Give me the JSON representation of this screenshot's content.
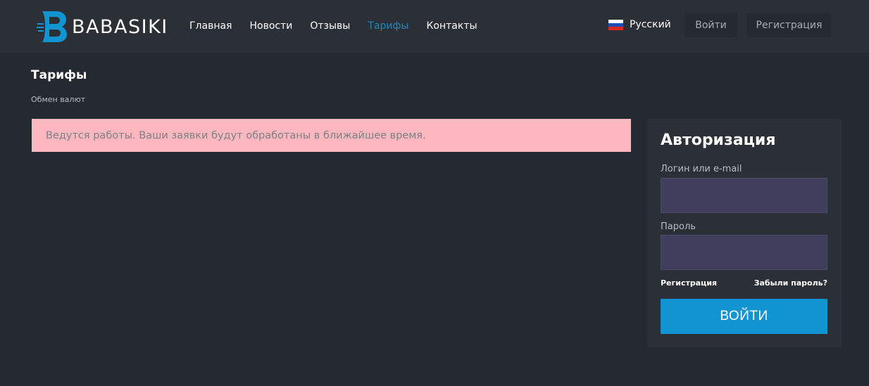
{
  "brand": {
    "name": "BABASIKI",
    "accent": "#1194d2"
  },
  "nav": {
    "items": [
      {
        "label": "Главная"
      },
      {
        "label": "Новости"
      },
      {
        "label": "Отзывы"
      },
      {
        "label": "Тарифы",
        "active": true
      },
      {
        "label": "Контакты"
      }
    ]
  },
  "language": {
    "label": "Русский",
    "icon": "russia-flag-icon"
  },
  "header_buttons": {
    "login": "Войти",
    "register": "Регистрация"
  },
  "page": {
    "title": "Тарифы",
    "breadcrumb": "Обмен валют"
  },
  "alert": {
    "text": "Ведутся работы. Ваши заявки будут обработаны в ближайшее время.",
    "color": "#fdb8bf"
  },
  "auth": {
    "title": "Авторизация",
    "login_label": "Логин или e-mail",
    "login_value": "",
    "password_label": "Пароль",
    "password_value": "",
    "register_link": "Регистрация",
    "forgot_link": "Забыли пароль?",
    "submit": "ВОЙТИ"
  }
}
